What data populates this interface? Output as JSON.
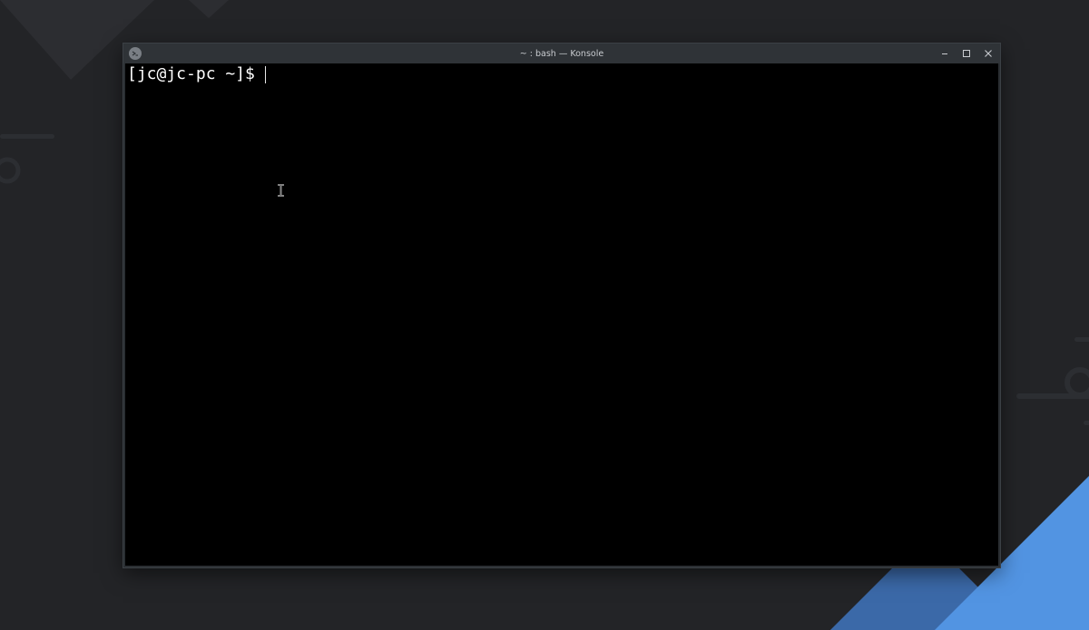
{
  "window": {
    "title": "~ : bash — Konsole",
    "app_icon": "konsole-icon",
    "controls": {
      "minimize": "minimize-icon",
      "maximize": "maximize-icon",
      "close": "close-icon"
    }
  },
  "terminal": {
    "prompt": "[jc@jc-pc ~]$",
    "input": ""
  },
  "colors": {
    "desktop": "#232427",
    "titlebar": "#2f3337",
    "terminal_bg": "#000000",
    "terminal_fg": "#ffffff",
    "accent": "#5294e2"
  }
}
